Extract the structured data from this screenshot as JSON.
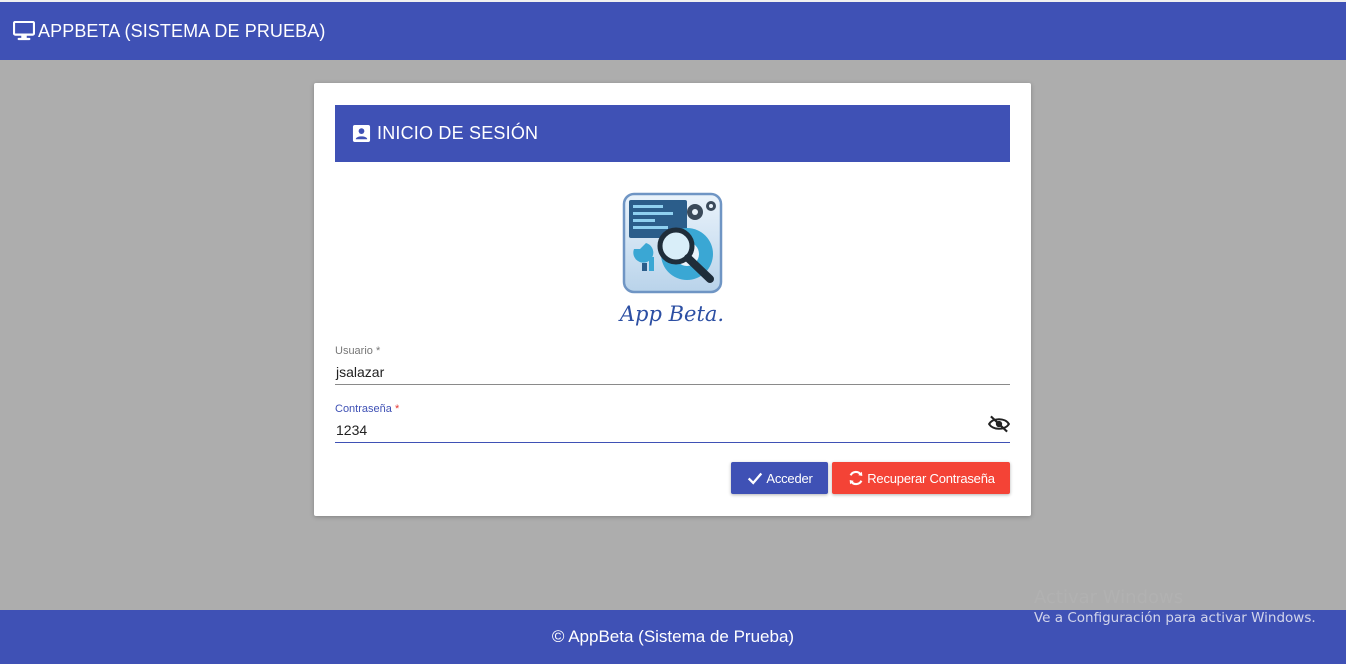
{
  "colors": {
    "primary": "#3f51b5",
    "danger": "#f44336",
    "background": "#adadad"
  },
  "topbar": {
    "icon": "desktop-monitor-icon",
    "title": "APPBETA (SISTEMA DE PRUEBA)"
  },
  "login_card": {
    "header_icon": "contact-card-icon",
    "header_title": "INICIO DE SESIÓN",
    "logo_text": "App Beta.",
    "username": {
      "label": "Usuario",
      "required_mark": "*",
      "value": "jsalazar"
    },
    "password": {
      "label": "Contraseña",
      "required_mark": "*",
      "value": "1234",
      "toggle_icon": "eye-off-icon"
    },
    "login_button": {
      "icon": "check-icon",
      "label": "Acceder"
    },
    "recover_button": {
      "icon": "refresh-icon",
      "label": "Recuperar Contraseña"
    }
  },
  "footer": {
    "text": "© AppBeta (Sistema de Prueba)"
  },
  "watermark": {
    "line1": "Activar Windows",
    "line2": "Ve a Configuración para activar Windows."
  }
}
